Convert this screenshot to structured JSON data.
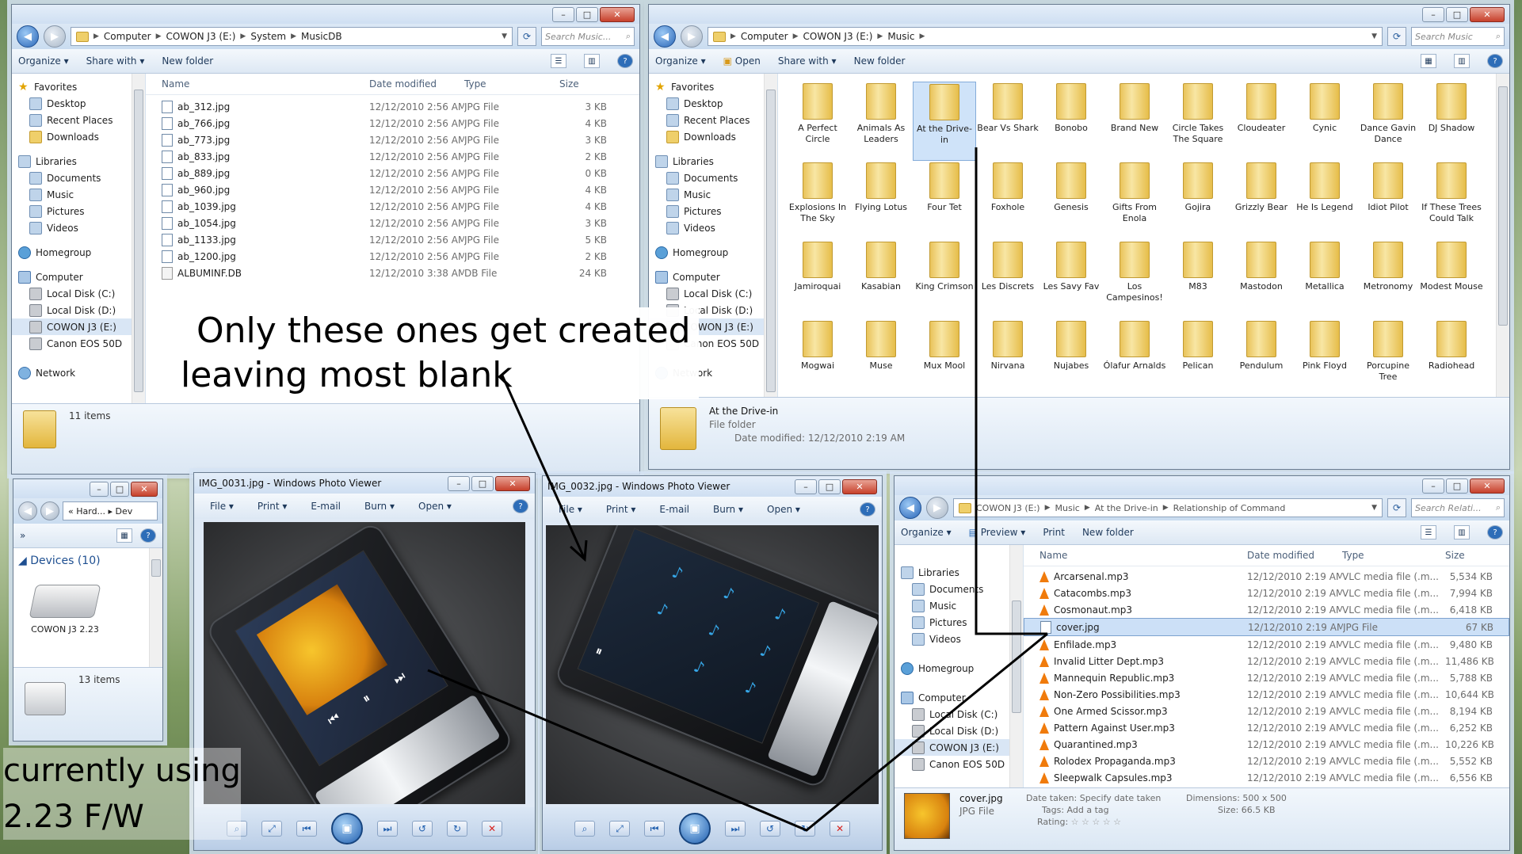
{
  "win_musicdb": {
    "breadcrumb": [
      "Computer",
      "COWON J3 (E:)",
      "System",
      "MusicDB"
    ],
    "search_placeholder": "Search Music...",
    "toolbar": {
      "organize": "Organize ▾",
      "share": "Share with ▾",
      "new_folder": "New folder"
    },
    "columns": {
      "name": "Name",
      "date": "Date modified",
      "type": "Type",
      "size": "Size"
    },
    "files": [
      {
        "name": "ab_312.jpg",
        "date": "12/12/2010 2:56 AM",
        "type": "JPG File",
        "size": "3 KB"
      },
      {
        "name": "ab_766.jpg",
        "date": "12/12/2010 2:56 AM",
        "type": "JPG File",
        "size": "4 KB"
      },
      {
        "name": "ab_773.jpg",
        "date": "12/12/2010 2:56 AM",
        "type": "JPG File",
        "size": "3 KB"
      },
      {
        "name": "ab_833.jpg",
        "date": "12/12/2010 2:56 AM",
        "type": "JPG File",
        "size": "2 KB"
      },
      {
        "name": "ab_889.jpg",
        "date": "12/12/2010 2:56 AM",
        "type": "JPG File",
        "size": "0 KB"
      },
      {
        "name": "ab_960.jpg",
        "date": "12/12/2010 2:56 AM",
        "type": "JPG File",
        "size": "4 KB"
      },
      {
        "name": "ab_1039.jpg",
        "date": "12/12/2010 2:56 AM",
        "type": "JPG File",
        "size": "4 KB"
      },
      {
        "name": "ab_1054.jpg",
        "date": "12/12/2010 2:56 AM",
        "type": "JPG File",
        "size": "3 KB"
      },
      {
        "name": "ab_1133.jpg",
        "date": "12/12/2010 2:56 AM",
        "type": "JPG File",
        "size": "5 KB"
      },
      {
        "name": "ab_1200.jpg",
        "date": "12/12/2010 2:56 AM",
        "type": "JPG File",
        "size": "2 KB"
      },
      {
        "name": "ALBUMINF.DB",
        "date": "12/12/2010 3:38 AM",
        "type": "DB File",
        "size": "24 KB"
      }
    ],
    "status": "11 items"
  },
  "nav": {
    "favorites": "Favorites",
    "desktop": "Desktop",
    "recent": "Recent Places",
    "downloads": "Downloads",
    "libraries": "Libraries",
    "documents": "Documents",
    "music": "Music",
    "pictures": "Pictures",
    "videos": "Videos",
    "homegroup": "Homegroup",
    "computer": "Computer",
    "disk_c": "Local Disk (C:)",
    "disk_d": "Local Disk (D:)",
    "cowon": "COWON J3 (E:)",
    "canon": "Canon EOS 50D",
    "network": "Network"
  },
  "win_music": {
    "breadcrumb": [
      "Computer",
      "COWON J3 (E:)",
      "Music"
    ],
    "search_placeholder": "Search Music",
    "toolbar": {
      "organize": "Organize ▾",
      "open": "Open",
      "share": "Share with ▾",
      "new_folder": "New folder"
    },
    "folders": [
      "A Perfect Circle",
      "Animals As Leaders",
      "At the Drive-in",
      "Bear Vs Shark",
      "Bonobo",
      "Brand New",
      "Circle Takes The Square",
      "Cloudeater",
      "Cynic",
      "Dance Gavin Dance",
      "DJ Shadow",
      "Explosions In The Sky",
      "Flying Lotus",
      "Four Tet",
      "Foxhole",
      "Genesis",
      "Gifts From Enola",
      "Gojira",
      "Grizzly Bear",
      "He Is Legend",
      "Idiot Pilot",
      "If These Trees Could Talk",
      "Jamiroquai",
      "Kasabian",
      "King Crimson",
      "Les Discrets",
      "Les Savy Fav",
      "Los Campesinos!",
      "M83",
      "Mastodon",
      "Metallica",
      "Metronomy",
      "Modest Mouse",
      "Mogwai",
      "Muse",
      "Mux Mool",
      "Nirvana",
      "Nujabes",
      "Ólafur Arnalds",
      "Pelican",
      "Pendulum",
      "Pink Floyd",
      "Porcupine Tree",
      "Radiohead",
      "",
      "",
      "",
      "",
      "",
      "",
      "",
      "",
      "",
      "",
      ""
    ],
    "detail_name": "At the Drive-in",
    "detail_type": "File folder",
    "detail_date": "Date modified: 12/12/2010 2:19 AM"
  },
  "win_devices": {
    "crumb": "« Hard... ▸ Dev",
    "group": "Devices (10)",
    "device": "COWON J3 2.23",
    "status": "13 items"
  },
  "pv1": {
    "title": "IMG_0031.jpg - Windows Photo Viewer",
    "menu": {
      "file": "File ▾",
      "print": "Print ▾",
      "email": "E-mail",
      "burn": "Burn ▾",
      "open": "Open ▾"
    }
  },
  "pv2": {
    "title": "IMG_0032.jpg - Windows Photo Viewer",
    "menu": {
      "file": "File ▾",
      "print": "Print ▾",
      "email": "E-mail",
      "burn": "Burn ▾",
      "open": "Open ▾"
    }
  },
  "win_album": {
    "breadcrumb": [
      "COWON J3 (E:)",
      "Music",
      "At the Drive-in",
      "Relationship of Command"
    ],
    "search_placeholder": "Search Relati...",
    "toolbar": {
      "organize": "Organize ▾",
      "preview": "Preview ▾",
      "print": "Print",
      "new_folder": "New folder"
    },
    "nav_partial": {
      "documents": "Documents",
      "computer": "Computer"
    },
    "columns": {
      "name": "Name",
      "date": "Date modified",
      "type": "Type",
      "size": "Size"
    },
    "files": [
      {
        "name": "Arcarsenal.mp3",
        "date": "12/12/2010 2:19 AM",
        "type": "VLC media file (.m...",
        "size": "5,534 KB",
        "kind": "mp3"
      },
      {
        "name": "Catacombs.mp3",
        "date": "12/12/2010 2:19 AM",
        "type": "VLC media file (.m...",
        "size": "7,994 KB",
        "kind": "mp3"
      },
      {
        "name": "Cosmonaut.mp3",
        "date": "12/12/2010 2:19 AM",
        "type": "VLC media file (.m...",
        "size": "6,418 KB",
        "kind": "mp3"
      },
      {
        "name": "cover.jpg",
        "date": "12/12/2010 2:19 AM",
        "type": "JPG File",
        "size": "67 KB",
        "kind": "jpg"
      },
      {
        "name": "Enfilade.mp3",
        "date": "12/12/2010 2:19 AM",
        "type": "VLC media file (.m...",
        "size": "9,480 KB",
        "kind": "mp3"
      },
      {
        "name": "Invalid Litter Dept.mp3",
        "date": "12/12/2010 2:19 AM",
        "type": "VLC media file (.m...",
        "size": "11,486 KB",
        "kind": "mp3"
      },
      {
        "name": "Mannequin Republic.mp3",
        "date": "12/12/2010 2:19 AM",
        "type": "VLC media file (.m...",
        "size": "5,788 KB",
        "kind": "mp3"
      },
      {
        "name": "Non-Zero Possibilities.mp3",
        "date": "12/12/2010 2:19 AM",
        "type": "VLC media file (.m...",
        "size": "10,644 KB",
        "kind": "mp3"
      },
      {
        "name": "One Armed Scissor.mp3",
        "date": "12/12/2010 2:19 AM",
        "type": "VLC media file (.m...",
        "size": "8,194 KB",
        "kind": "mp3"
      },
      {
        "name": "Pattern Against User.mp3",
        "date": "12/12/2010 2:19 AM",
        "type": "VLC media file (.m...",
        "size": "6,252 KB",
        "kind": "mp3"
      },
      {
        "name": "Quarantined.mp3",
        "date": "12/12/2010 2:19 AM",
        "type": "VLC media file (.m...",
        "size": "10,226 KB",
        "kind": "mp3"
      },
      {
        "name": "Rolodex Propaganda.mp3",
        "date": "12/12/2010 2:19 AM",
        "type": "VLC media file (.m...",
        "size": "5,552 KB",
        "kind": "mp3"
      },
      {
        "name": "Sleepwalk Capsules.mp3",
        "date": "12/12/2010 2:19 AM",
        "type": "VLC media file (.m...",
        "size": "6,556 KB",
        "kind": "mp3"
      }
    ],
    "detail": {
      "name": "cover.jpg",
      "type": "JPG File",
      "date_taken": "Date taken: Specify date taken",
      "tags": "Tags: Add a tag",
      "rating": "Rating:",
      "stars": "☆ ☆ ☆ ☆ ☆",
      "dimensions": "Dimensions: 500 x 500",
      "size": "Size: 66.5 KB"
    }
  },
  "annotations": {
    "created_line1": "Only these ones get created",
    "created_line2": "leaving most blank",
    "fw_line1": "currently using",
    "fw_line2": "2.23 F/W"
  },
  "colors": {
    "selection": "#cce0f7",
    "titlebar": "#d6e4f4",
    "folder": "#efcf6a",
    "vlc": "#f07b0c",
    "note": "#36a6e6"
  }
}
